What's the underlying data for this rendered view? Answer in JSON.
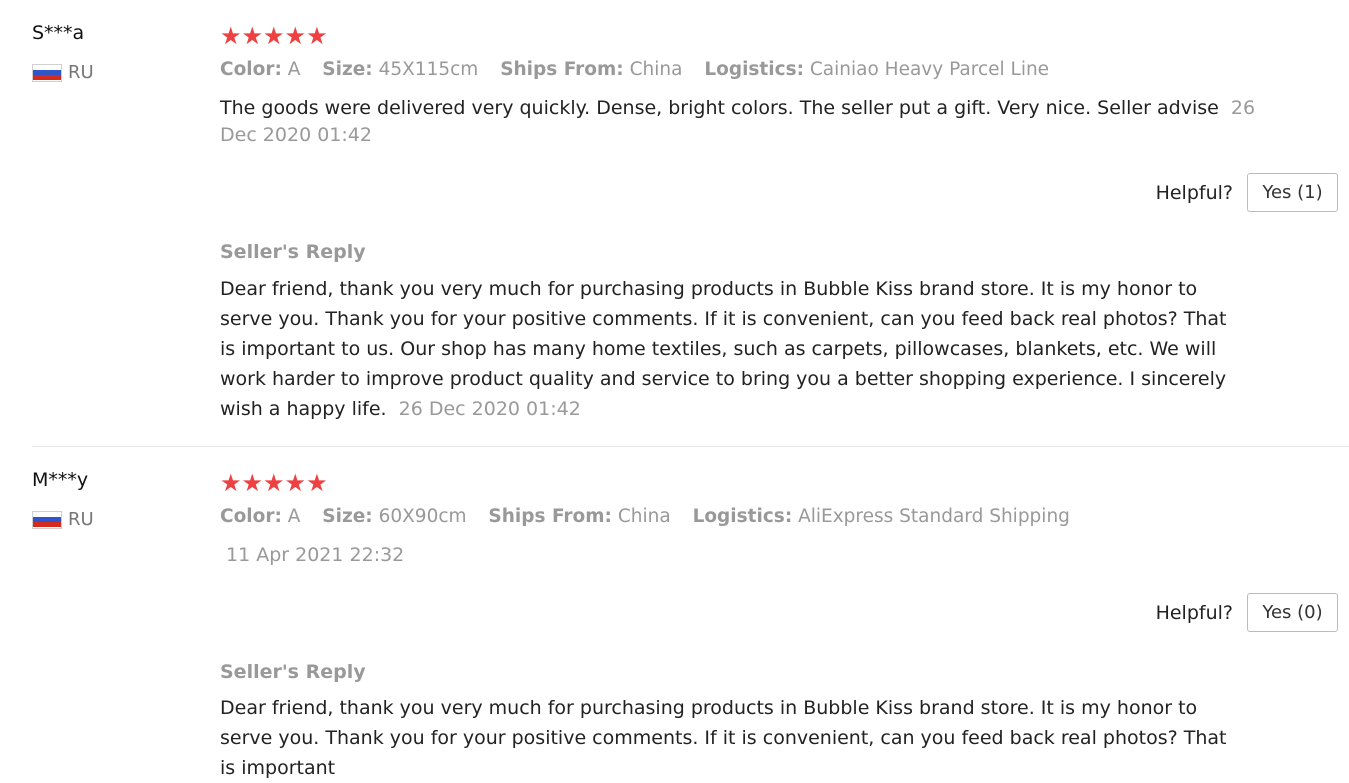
{
  "reviews": [
    {
      "user": "S***a",
      "country": "RU",
      "stars": "★★★★★",
      "color_label": "Color:",
      "color": "A",
      "size_label": "Size:",
      "size": "45X115cm",
      "ships_label": "Ships From:",
      "ships": "China",
      "logistics_label": "Logistics:",
      "logistics": "Cainiao Heavy Parcel Line",
      "text": "The goods were delivered very quickly. Dense, bright colors. The seller put a gift. Very nice. Seller advise",
      "date": "26 Dec 2020 01:42",
      "helpful_label": "Helpful?",
      "yes_label": "Yes (1)",
      "reply_heading": "Seller's Reply",
      "reply_text": "Dear friend, thank you very much for purchasing products in Bubble Kiss brand store. It is my honor to serve you. Thank you for your positive comments. If it is convenient, can you feed back real photos? That is important to us. Our shop has many home textiles, such as carpets, pillowcases, blankets, etc. We will work harder to improve product quality and service to bring you a better shopping experience. I sincerely wish a happy life.",
      "reply_date": "26 Dec 2020 01:42"
    },
    {
      "user": "M***y",
      "country": "RU",
      "stars": "★★★★★",
      "color_label": "Color:",
      "color": "A",
      "size_label": "Size:",
      "size": "60X90cm",
      "ships_label": "Ships From:",
      "ships": "China",
      "logistics_label": "Logistics:",
      "logistics": "AliExpress Standard Shipping",
      "text": "",
      "date": "11 Apr 2021 22:32",
      "helpful_label": "Helpful?",
      "yes_label": "Yes (0)",
      "reply_heading": "Seller's Reply",
      "reply_text": "Dear friend, thank you very much for purchasing products in Bubble Kiss brand store. It is my honor to serve you. Thank you for your positive comments. If it is convenient, can you feed back real photos? That is important"
    }
  ],
  "colors": {
    "star": "#ee4141",
    "muted": "#999999",
    "text": "#222222"
  }
}
